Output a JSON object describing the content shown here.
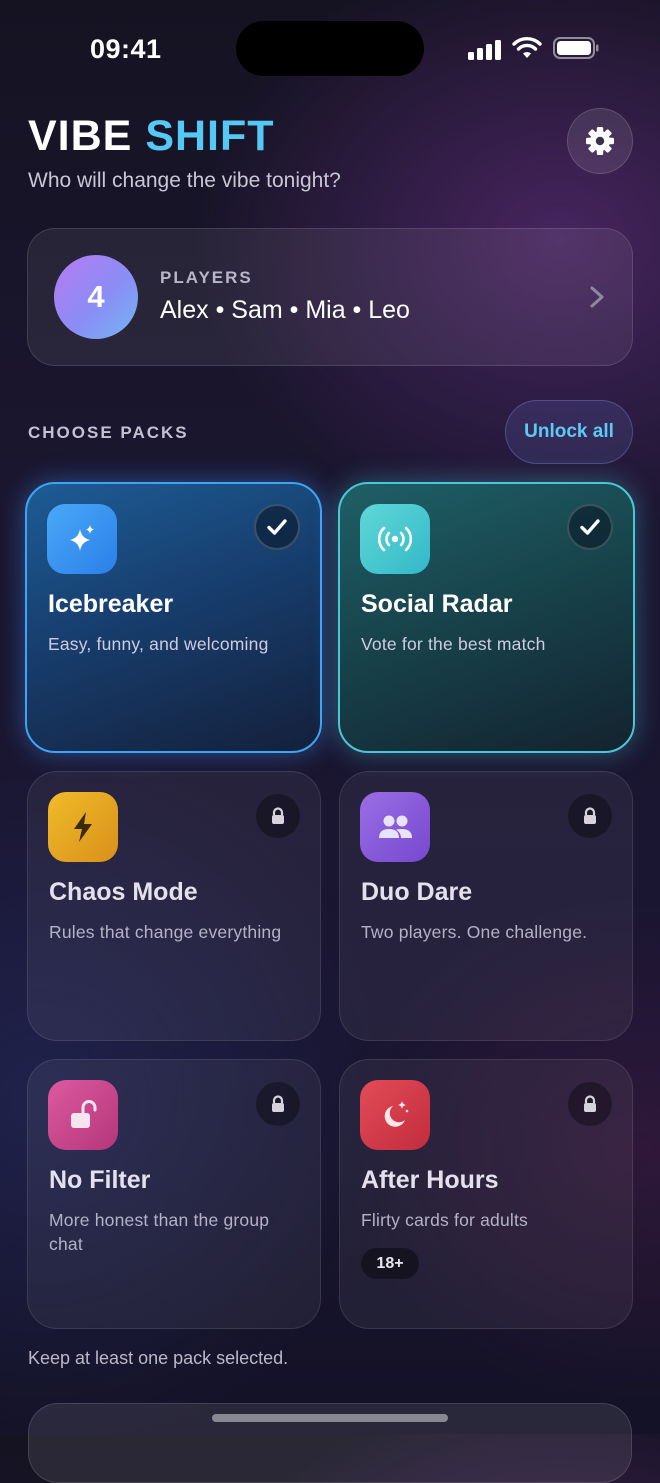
{
  "status_bar": {
    "time": "09:41"
  },
  "header": {
    "logo_word1": "VIBE",
    "logo_word2": "SHIFT",
    "subtitle": "Who will change the vibe tonight?",
    "settings_icon": "gear-icon"
  },
  "players": {
    "count": "4",
    "label": "PLAYERS",
    "names": "Alex • Sam • Mia • Leo"
  },
  "packs_section": {
    "label": "CHOOSE PACKS",
    "unlock_all": "Unlock all",
    "footer_note": "Keep at least one pack selected."
  },
  "packs": [
    {
      "title": "Icebreaker",
      "description": "Easy, funny, and welcoming",
      "selected": true,
      "locked": false,
      "icon": "sparkles-icon",
      "color": "#2f8ff5"
    },
    {
      "title": "Social Radar",
      "description": "Vote for the best match",
      "selected": true,
      "locked": false,
      "icon": "radar-icon",
      "color": "#45c4cf"
    },
    {
      "title": "Chaos Mode",
      "description": "Rules that change everything",
      "selected": false,
      "locked": true,
      "icon": "lightning-icon",
      "color": "#e2a21c"
    },
    {
      "title": "Duo Dare",
      "description": "Two players. One challenge.",
      "selected": false,
      "locked": true,
      "icon": "people-icon",
      "color": "#8a5ed8"
    },
    {
      "title": "No Filter",
      "description": "More honest than the group chat",
      "selected": false,
      "locked": true,
      "icon": "unlock-icon",
      "color": "#c8448a"
    },
    {
      "title": "After Hours",
      "description": "Flirty cards for adults",
      "selected": false,
      "locked": true,
      "icon": "moon-stars-icon",
      "color": "#d8394a",
      "badge": "18+"
    }
  ],
  "colors": {
    "accent": "#56c8f5",
    "background": "#1b1630"
  }
}
